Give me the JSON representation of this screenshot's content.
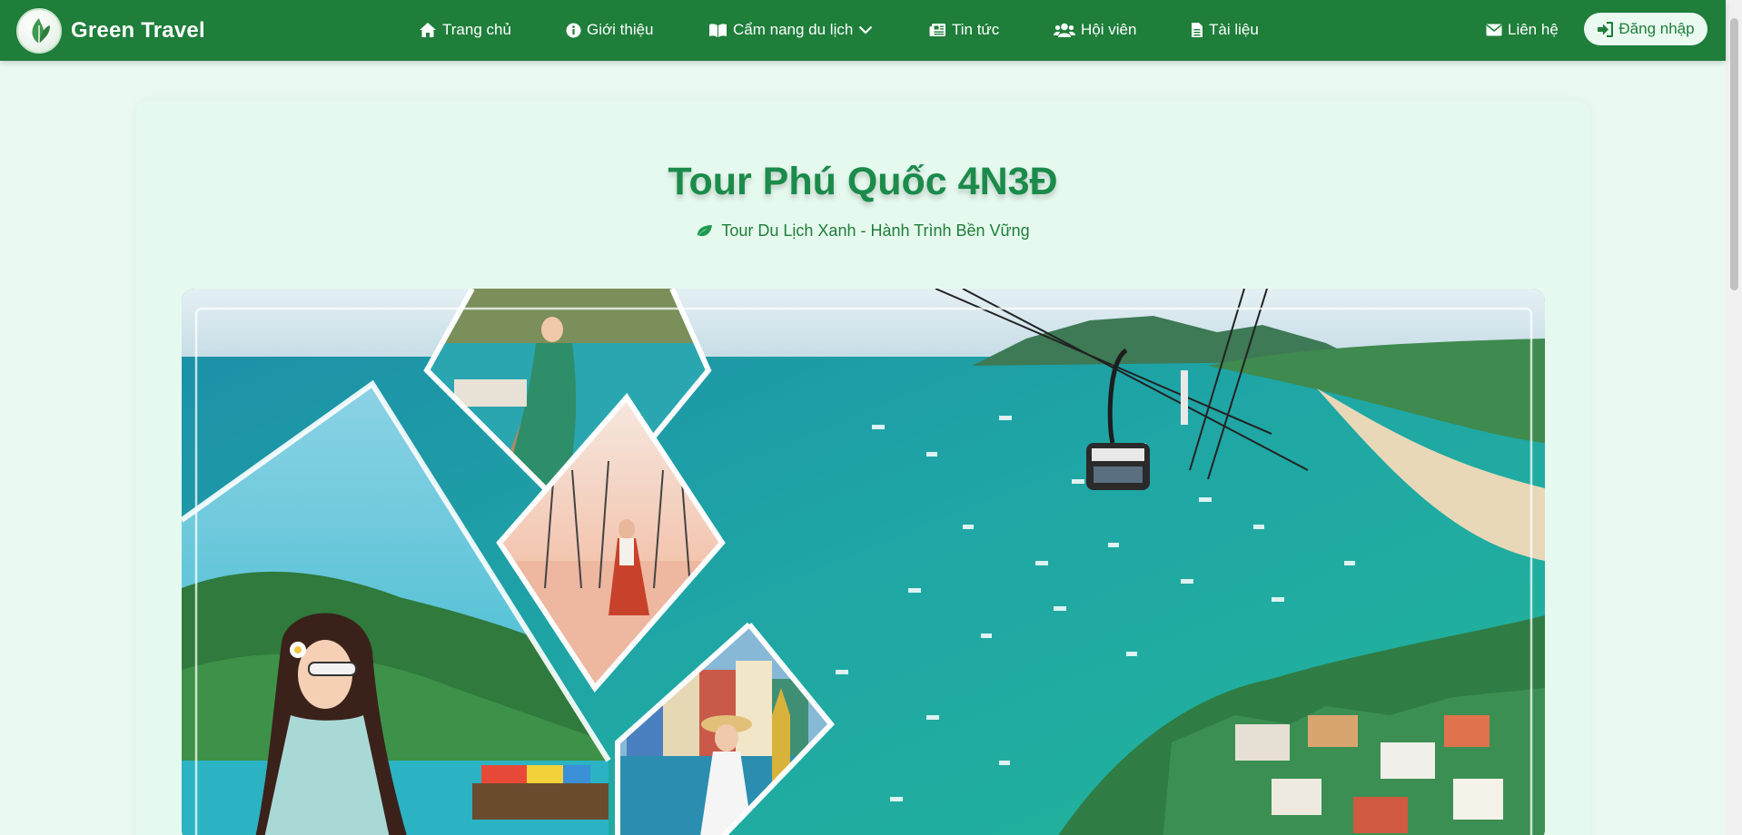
{
  "brand": {
    "name": "Green Travel",
    "logo_icon": "leaf-logo-icon"
  },
  "nav": {
    "home": "Trang chủ",
    "about": "Giới thiệu",
    "handbook": "Cẩm nang du lịch",
    "news": "Tin tức",
    "members": "Hội viên",
    "documents": "Tài liệu",
    "contact": "Liên hệ",
    "login": "Đăng nhập"
  },
  "colors": {
    "nav_bg": "#1e7e3a",
    "page_bg": "#eafaf1",
    "title": "#1b8b4b",
    "accent": "#1e7e3a"
  },
  "page": {
    "title": "Tour Phú Quốc 4N3Đ",
    "subtitle": "Tour Du Lịch Xanh - Hành Trình Bền Vững"
  }
}
